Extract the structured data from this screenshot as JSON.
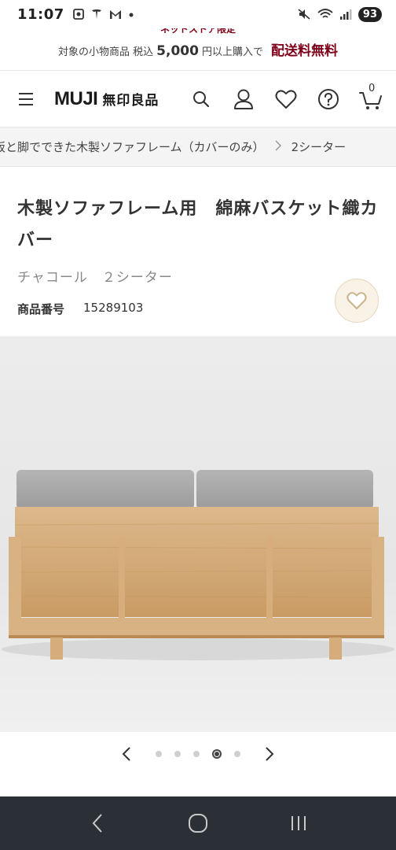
{
  "status_bar": {
    "time": "11:07",
    "battery": "93",
    "icons": [
      "screen-record-icon",
      "tesla-icon",
      "gmail-icon",
      "dot-icon",
      "mute-icon",
      "wifi-icon",
      "signal-icon"
    ]
  },
  "promo": {
    "top_text": "ネットストア限定",
    "prefix": "対象の小物商品 税込",
    "amount": "5,000",
    "suffix": "円以上購入で",
    "highlight": "配送料無料",
    "highlight_color": "#7f0019"
  },
  "header": {
    "logo_latin": "MUJI",
    "logo_jp": "無印良品",
    "cart_count": "0",
    "icons": [
      "menu-icon",
      "search-icon",
      "account-icon",
      "favorite-icon",
      "help-icon",
      "cart-icon"
    ]
  },
  "breadcrumb": {
    "items": [
      "板と脚でできた木製ソファフレーム（カバーのみ）",
      "2シーター"
    ]
  },
  "product": {
    "title": "木製ソファフレーム用　綿麻バスケット織カバー",
    "variant": "チャコール　２シーター",
    "code_label": "商品番号",
    "code": "15289103",
    "favorite_accent": "#e5d7bd"
  },
  "carousel": {
    "total": 5,
    "active_index": 3
  }
}
